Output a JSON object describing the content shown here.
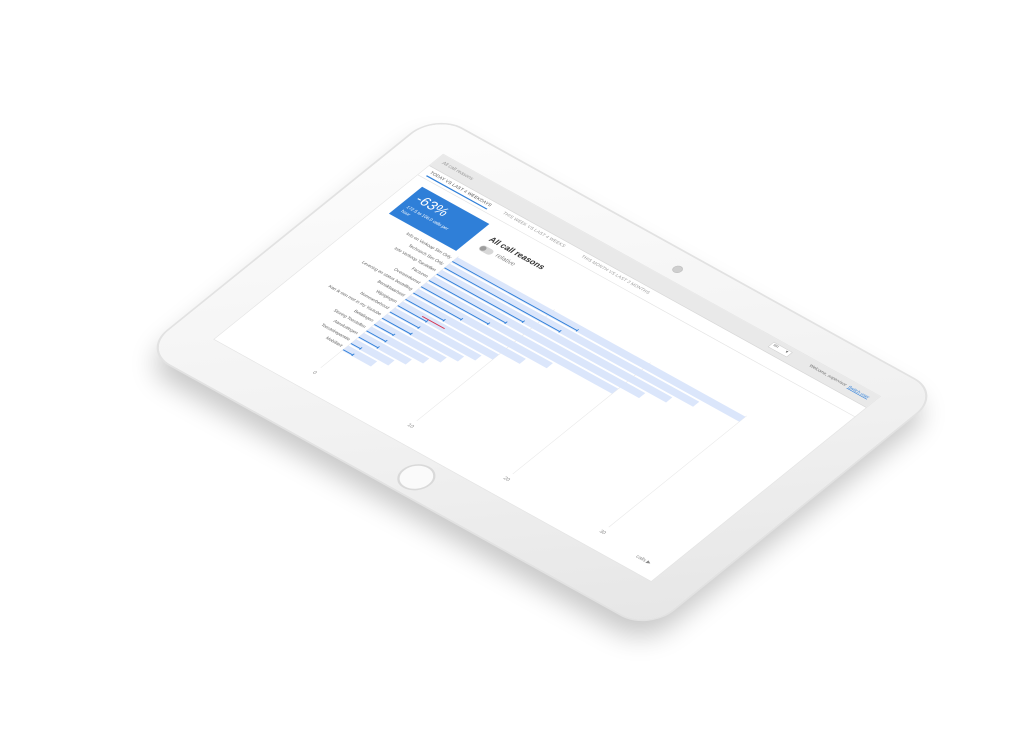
{
  "header": {
    "breadcrumb": "All call reasons",
    "language": "en",
    "welcome": "Welcome, supervisor",
    "switch_user": "Switch user"
  },
  "tabs": [
    {
      "label": "TODAY VS LAST 4 WEEKDAYS",
      "active": true
    },
    {
      "label": "THIS WEEK VS LAST 4 WEEKS",
      "active": false
    },
    {
      "label": "THIS MONTH VS LAST 3 MONTHS",
      "active": false
    }
  ],
  "kpi": {
    "percent": "-63%",
    "detail_line1": "172.5 to 106.0 calls per",
    "detail_line2": "hour",
    "color": "#2f7fd8"
  },
  "title": "All call reasons",
  "toggle": {
    "label": "relative",
    "on": false
  },
  "chart_data": {
    "type": "bar",
    "orientation": "horizontal",
    "categories": [
      "Info en Verkoop Sim Only",
      "Technisch Sim Only",
      "Info Verkoop Toestellen",
      "Facturen",
      "Overeenkomst",
      "Levering en status bestelling",
      "Bereikbaarheid",
      "Wijzigingen",
      "Nummerbehoud",
      "Kan ik een met in my Youtube",
      "Betalingen",
      "Storing Toestellen",
      "Aansluitingen",
      "Toestelreparatie",
      "Mobiliteit"
    ],
    "series": [
      {
        "values": [
          30,
          26,
          24,
          22,
          20,
          14,
          12,
          10,
          9,
          8,
          7,
          6,
          5,
          4,
          3
        ],
        "color": "#dbe6fb"
      },
      {
        "values": [
          13,
          12,
          9,
          8,
          7,
          5,
          4,
          3,
          3,
          3,
          2,
          2,
          2,
          1,
          1
        ],
        "color": "#2f7fd8"
      }
    ],
    "x_ticks": [
      "0",
      "10",
      "20",
      "30"
    ],
    "xlim": [
      0,
      35
    ],
    "xlabel": "calls",
    "highlight_color": "#d9314c"
  },
  "calls_axis_label": "calls ▶"
}
